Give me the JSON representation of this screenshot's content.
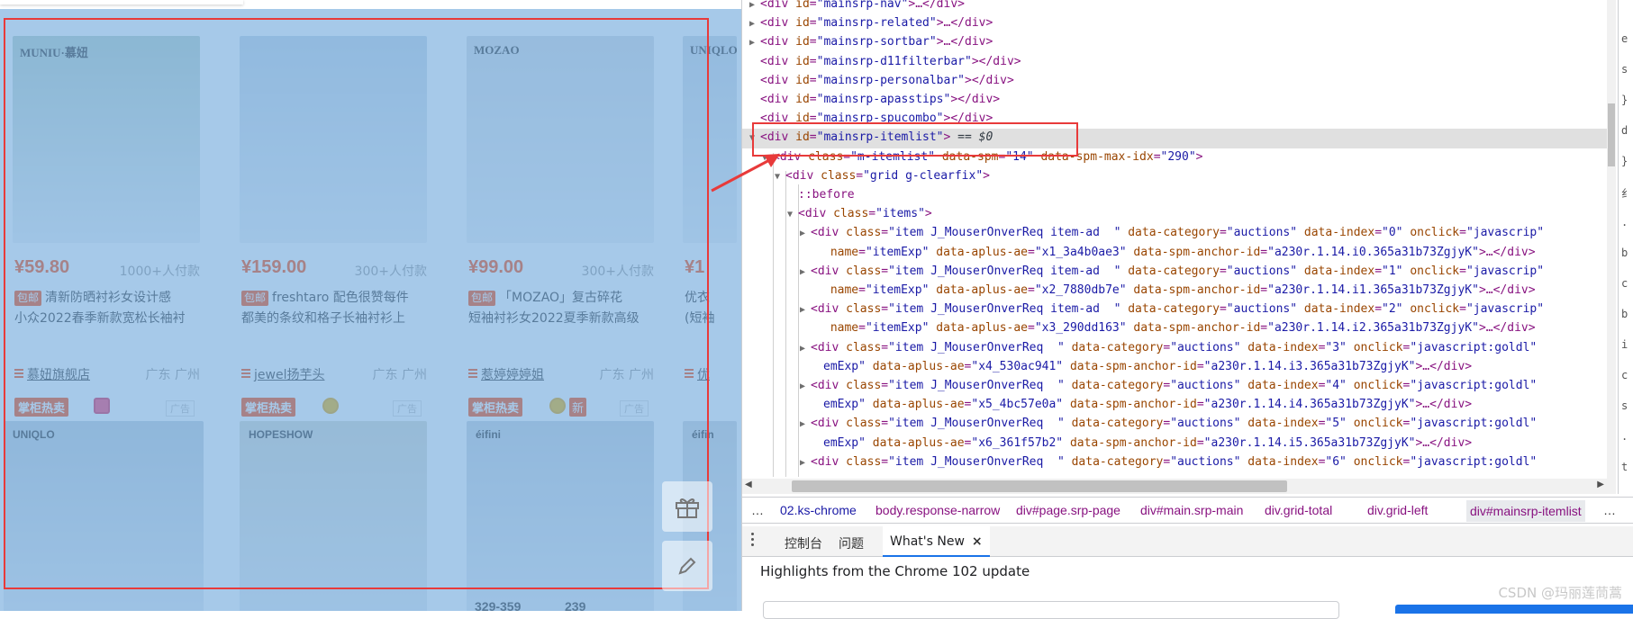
{
  "page": {
    "products_row1": [
      {
        "price": "¥59.80",
        "buyers": "1000+人付款",
        "tag": "包邮",
        "title_l1": "清新防晒衬衫女设计感",
        "title_l2": "小众2022春季新款宽松长袖衬",
        "shop": "慕妞旗舰店",
        "loc": "广东 广州",
        "badge": "掌柜热卖",
        "ad": "广告",
        "img_brand": "MUNIU·慕妞",
        "img_color": "#b9d0c6"
      },
      {
        "price": "¥159.00",
        "buyers": "300+人付款",
        "tag": "包邮",
        "title_l1": "freshtaro 配色很赞每件",
        "title_l2": "都美的条纹和格子长袖衬衫上",
        "shop": "jewel扬芋头",
        "loc": "广东 广州",
        "badge": "掌柜热卖",
        "ad": "广告",
        "img_brand": "",
        "img_color": "#c9d7e4"
      },
      {
        "price": "¥99.00",
        "buyers": "300+人付款",
        "tag": "包邮",
        "title_l1": "「MOZAO」复古碎花",
        "title_l2": "短袖衬衫女2022夏季新款高级",
        "shop": "惹婷婷婷姐",
        "loc": "广东 广州",
        "badge": "掌柜热卖",
        "ad": "广告",
        "img_brand": "MOZAO",
        "img_color": "#d8dde2"
      },
      {
        "price": "¥1",
        "buyers": "",
        "tag": "",
        "title_l1": "优衣",
        "title_l2": "(短袖",
        "shop": "优",
        "loc": "",
        "badge": "",
        "ad": "",
        "img_brand": "UNIQLO",
        "img_color": "#cfd9e3"
      }
    ],
    "products_row2": [
      {
        "img_brand": "UNIQLO",
        "img_color": "#c3cfd9"
      },
      {
        "img_brand": "HOPESHOW",
        "img_color": "#d7d9cf"
      },
      {
        "img_brand": "éifini",
        "img_color": "#c9d3dd"
      },
      {
        "img_brand": "éifin",
        "img_color": "#d0d6dc"
      }
    ],
    "row2_bottom": [
      "329-359",
      "239"
    ],
    "side_icons": [
      "gift-icon",
      "edit-icon"
    ]
  },
  "devtools": {
    "elements_lines": [
      {
        "indent": 1,
        "tri": "▶",
        "tag": "div",
        "attrs": [
          [
            "id",
            "mainsrp-nav"
          ]
        ],
        "tail": ">…</div>"
      },
      {
        "indent": 1,
        "tri": "▶",
        "tag": "div",
        "attrs": [
          [
            "id",
            "mainsrp-related"
          ]
        ],
        "tail": ">…</div>"
      },
      {
        "indent": 1,
        "tri": "▶",
        "tag": "div",
        "attrs": [
          [
            "id",
            "mainsrp-sortbar"
          ]
        ],
        "tail": ">…</div>"
      },
      {
        "indent": 1,
        "tri": "",
        "tag": "div",
        "attrs": [
          [
            "id",
            "mainsrp-d11filterbar"
          ]
        ],
        "tail": "></div>"
      },
      {
        "indent": 1,
        "tri": "",
        "tag": "div",
        "attrs": [
          [
            "id",
            "mainsrp-personalbar"
          ]
        ],
        "tail": "></div>"
      },
      {
        "indent": 1,
        "tri": "",
        "tag": "div",
        "attrs": [
          [
            "id",
            "mainsrp-apasstips"
          ]
        ],
        "tail": "></div>"
      },
      {
        "indent": 1,
        "tri": "",
        "tag": "div",
        "attrs": [
          [
            "id",
            "mainsrp-spucombo"
          ]
        ],
        "tail": "></div>"
      },
      {
        "indent": 1,
        "tri": "▼",
        "tag": "div",
        "attrs": [
          [
            "id",
            "mainsrp-itemlist"
          ]
        ],
        "tail": ">",
        "selected": " == $0"
      },
      {
        "indent": 2,
        "tri": "▼",
        "tag": "div",
        "attrs": [
          [
            "class",
            "m-itemlist"
          ],
          [
            "data-spm",
            "14"
          ],
          [
            "data-spm-max-idx",
            "290"
          ]
        ],
        "tail": ">"
      },
      {
        "indent": 3,
        "tri": "▼",
        "tag": "div",
        "attrs": [
          [
            "class",
            "grid g-clearfix"
          ]
        ],
        "tail": ">"
      },
      {
        "indent": 4,
        "tri": "",
        "pseudo": "::before"
      },
      {
        "indent": 4,
        "tri": "▼",
        "tag": "div",
        "attrs": [
          [
            "class",
            "items"
          ]
        ],
        "tail": ">"
      },
      {
        "indent": 5,
        "tri": "▶",
        "tag": "div",
        "attrs": [
          [
            "class",
            "item J_MouserOnverReq item-ad  "
          ],
          [
            "data-category",
            "auctions"
          ],
          [
            "data-index",
            "0"
          ],
          [
            "onclick",
            "javascrip"
          ]
        ],
        "tail": ""
      },
      {
        "indent": 5,
        "tri": "",
        "cont": true,
        "attrs": [
          [
            "name",
            "itemExp"
          ],
          [
            "data-aplus-ae",
            "x1_3a4b0ae3"
          ],
          [
            "data-spm-anchor-id",
            "a230r.1.14.i0.365a31b73ZgjyK"
          ]
        ],
        "tail": ">…</div>"
      },
      {
        "indent": 5,
        "tri": "▶",
        "tag": "div",
        "attrs": [
          [
            "class",
            "item J_MouserOnverReq item-ad  "
          ],
          [
            "data-category",
            "auctions"
          ],
          [
            "data-index",
            "1"
          ],
          [
            "onclick",
            "javascrip"
          ]
        ],
        "tail": ""
      },
      {
        "indent": 5,
        "tri": "",
        "cont": true,
        "attrs": [
          [
            "name",
            "itemExp"
          ],
          [
            "data-aplus-ae",
            "x2_7880db7e"
          ],
          [
            "data-spm-anchor-id",
            "a230r.1.14.i1.365a31b73ZgjyK"
          ]
        ],
        "tail": ">…</div>"
      },
      {
        "indent": 5,
        "tri": "▶",
        "tag": "div",
        "attrs": [
          [
            "class",
            "item J_MouserOnverReq item-ad  "
          ],
          [
            "data-category",
            "auctions"
          ],
          [
            "data-index",
            "2"
          ],
          [
            "onclick",
            "javascrip"
          ]
        ],
        "tail": ""
      },
      {
        "indent": 5,
        "tri": "",
        "cont": true,
        "attrs": [
          [
            "name",
            "itemExp"
          ],
          [
            "data-aplus-ae",
            "x3_290dd163"
          ],
          [
            "data-spm-anchor-id",
            "a230r.1.14.i2.365a31b73ZgjyK"
          ]
        ],
        "tail": ">…</div>"
      },
      {
        "indent": 5,
        "tri": "▶",
        "tag": "div",
        "attrs": [
          [
            "class",
            "item J_MouserOnverReq  "
          ],
          [
            "data-category",
            "auctions"
          ],
          [
            "data-index",
            "3"
          ],
          [
            "onclick",
            "javascript:goldl"
          ]
        ],
        "tail": ""
      },
      {
        "indent": 5,
        "tri": "",
        "cont": true,
        "raw": "emExp\"",
        "attrs": [
          [
            "data-aplus-ae",
            "x4_530ac941"
          ],
          [
            "data-spm-anchor-id",
            "a230r.1.14.i3.365a31b73ZgjyK"
          ]
        ],
        "tail": ">…</div>"
      },
      {
        "indent": 5,
        "tri": "▶",
        "tag": "div",
        "attrs": [
          [
            "class",
            "item J_MouserOnverReq  "
          ],
          [
            "data-category",
            "auctions"
          ],
          [
            "data-index",
            "4"
          ],
          [
            "onclick",
            "javascript:goldl"
          ]
        ],
        "tail": ""
      },
      {
        "indent": 5,
        "tri": "",
        "cont": true,
        "raw": "emExp\"",
        "attrs": [
          [
            "data-aplus-ae",
            "x5_4bc57e0a"
          ],
          [
            "data-spm-anchor-id",
            "a230r.1.14.i4.365a31b73ZgjyK"
          ]
        ],
        "tail": ">…</div>"
      },
      {
        "indent": 5,
        "tri": "▶",
        "tag": "div",
        "attrs": [
          [
            "class",
            "item J_MouserOnverReq  "
          ],
          [
            "data-category",
            "auctions"
          ],
          [
            "data-index",
            "5"
          ],
          [
            "onclick",
            "javascript:goldl"
          ]
        ],
        "tail": ""
      },
      {
        "indent": 5,
        "tri": "",
        "cont": true,
        "raw": "emExp\"",
        "attrs": [
          [
            "data-aplus-ae",
            "x6_361f57b2"
          ],
          [
            "data-spm-anchor-id",
            "a230r.1.14.i5.365a31b73ZgjyK"
          ]
        ],
        "tail": ">…</div>"
      },
      {
        "indent": 5,
        "tri": "▶",
        "tag": "div",
        "attrs": [
          [
            "class",
            "item J_MouserOnverReq  "
          ],
          [
            "data-category",
            "auctions"
          ],
          [
            "data-index",
            "6"
          ],
          [
            "onclick",
            "javascript:goldl"
          ]
        ],
        "tail": ""
      }
    ],
    "breadcrumbs": [
      {
        "text": "…",
        "kind": "plain"
      },
      {
        "text": "02.ks-chrome",
        "kind": "class"
      },
      {
        "text": "body.response-narrow",
        "kind": "tag"
      },
      {
        "text": "div#page.srp-page",
        "kind": "tag"
      },
      {
        "text": "div#main.srp-main",
        "kind": "tag"
      },
      {
        "text": "div.grid-total",
        "kind": "tag"
      },
      {
        "text": "div.grid-left",
        "kind": "tag"
      },
      {
        "text": "div#mainsrp-itemlist",
        "kind": "active"
      },
      {
        "text": "…",
        "kind": "plain"
      }
    ],
    "drawer_tabs": {
      "console": "控制台",
      "issues": "问题",
      "whats_new": "What's New",
      "close": "×"
    },
    "whats_new_headline": "Highlights from the Chrome 102 update",
    "right_strip": [
      "e",
      "s",
      "}",
      "d",
      "}",
      "纟",
      ".",
      "b",
      "c",
      "b",
      "i",
      "c",
      "s",
      ".",
      "t"
    ]
  },
  "watermark": "CSDN @玛丽莲茼蒿",
  "colors": {
    "overlay": "#6fa8dc",
    "highlight": "#e83a3a",
    "accent": "#ff4400",
    "devtools_blue": "#1a73e8"
  }
}
